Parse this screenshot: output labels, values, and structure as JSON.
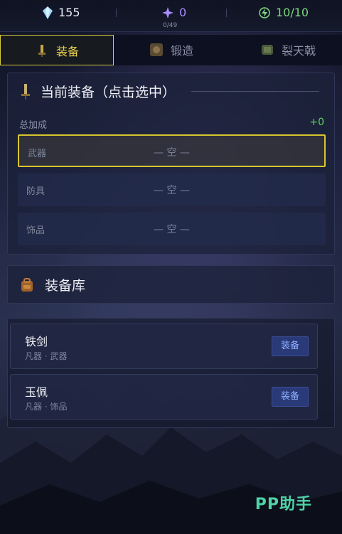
{
  "resources": {
    "gems": "155",
    "crystals": "0",
    "crystals_sub": "0/49",
    "energy": "10/10",
    "colors": {
      "gems": "#9fd8ff",
      "crystals": "#a98cff",
      "energy": "#7dd87d"
    }
  },
  "tabs": [
    {
      "label": "装备",
      "icon": "equipment-icon",
      "active": true
    },
    {
      "label": "锻造",
      "icon": "forge-icon",
      "active": false
    },
    {
      "label": "裂天戟",
      "icon": "halberd-icon",
      "active": false
    }
  ],
  "current_equipment": {
    "title": "当前装备（点击选中）",
    "bonus_label": "总加成",
    "bonus_value": "+0",
    "slots": [
      {
        "label": "武器",
        "value": "— 空 —",
        "selected": true
      },
      {
        "label": "防具",
        "value": "— 空 —",
        "selected": false
      },
      {
        "label": "饰品",
        "value": "— 空 —",
        "selected": false
      }
    ]
  },
  "inventory": {
    "title": "装备库",
    "items": [
      {
        "name": "铁剑",
        "meta": "凡器 · 武器",
        "button": "装备"
      },
      {
        "name": "玉佩",
        "meta": "凡器 · 饰品",
        "button": "装备"
      }
    ]
  },
  "watermark": "PP助手",
  "accent": {
    "highlight": "#d6c62e",
    "bonus": "#5cd65c",
    "button": "#2a3a78"
  }
}
